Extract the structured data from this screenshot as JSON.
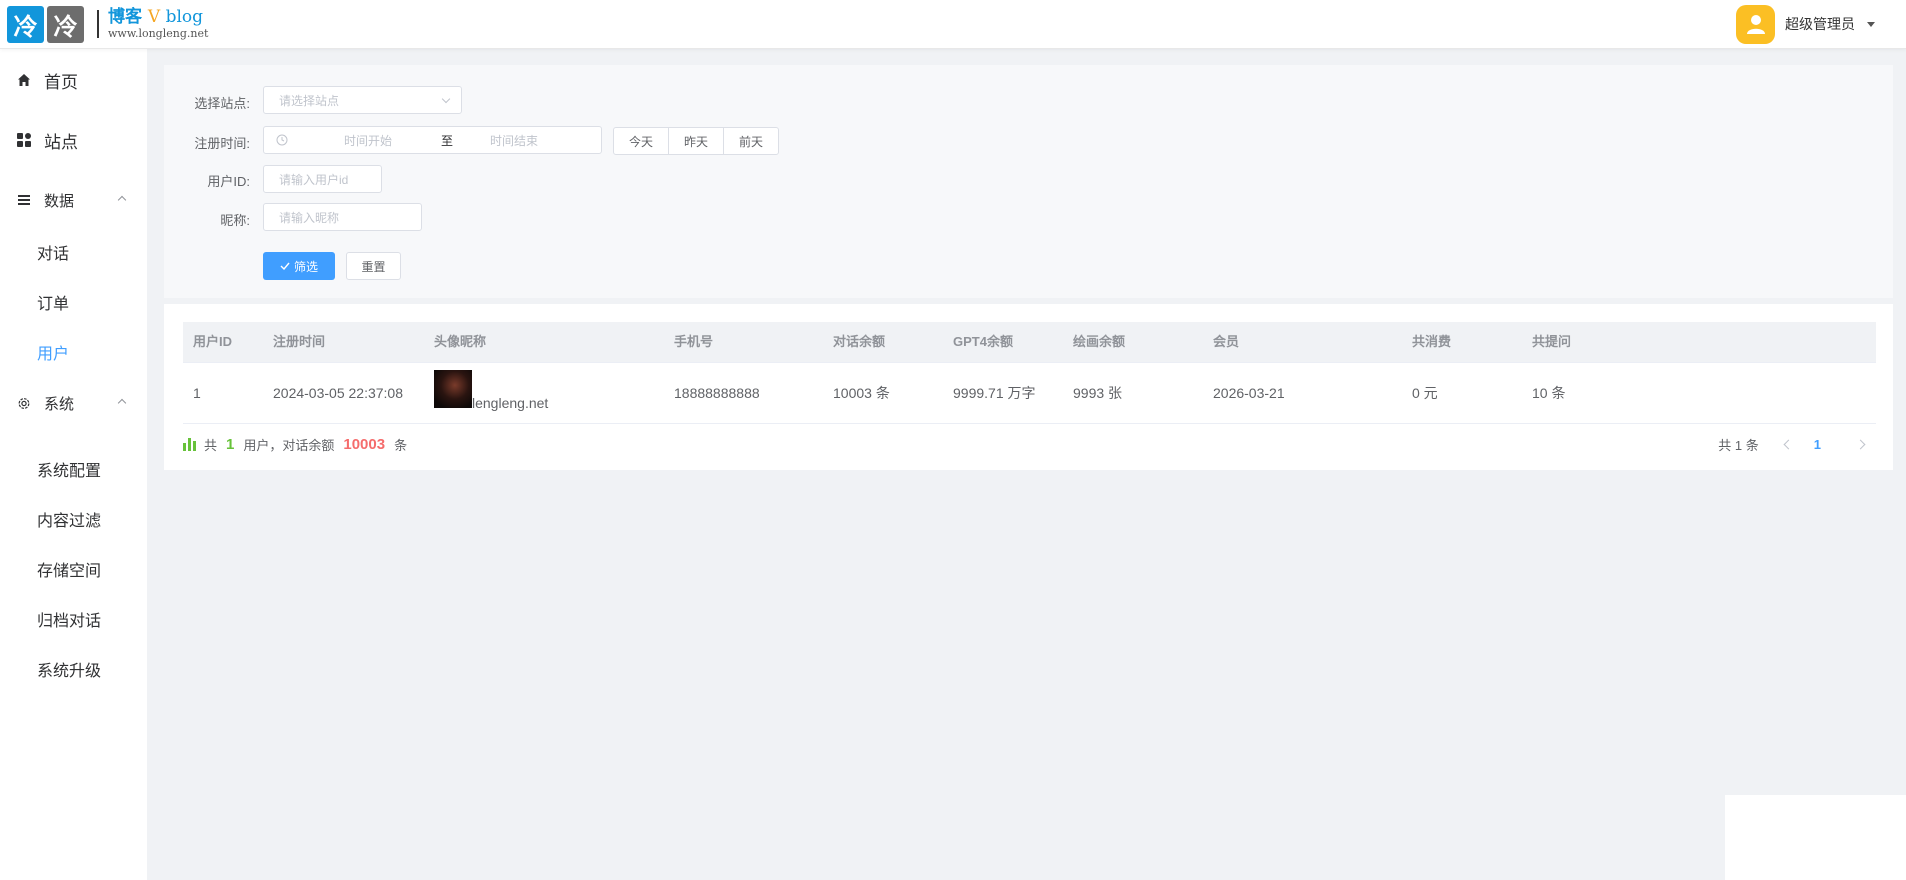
{
  "header": {
    "logo_char_1": "冷",
    "logo_char_2": "冷",
    "logo_title_a": "博客 ",
    "logo_title_v": "V",
    "logo_title_b": " blog",
    "logo_url": "www.longleng.net",
    "user_name": "超级管理员"
  },
  "sidebar": {
    "home": "首页",
    "sites": "站点",
    "data_group": "数据",
    "data_items": [
      "对话",
      "订单",
      "用户"
    ],
    "system_group": "系统",
    "system_items": [
      "系统配置",
      "内容过滤",
      "存储空间",
      "归档对话",
      "系统升级"
    ],
    "active_item": "用户"
  },
  "filters": {
    "site_label": "选择站点:",
    "site_placeholder": "请选择站点",
    "reg_time_label": "注册时间:",
    "time_start_placeholder": "时间开始",
    "time_sep": "至",
    "time_end_placeholder": "时间结束",
    "quick_ranges": [
      "今天",
      "昨天",
      "前天"
    ],
    "user_id_label": "用户ID:",
    "user_id_placeholder": "请输入用户id",
    "nickname_label": "昵称:",
    "nickname_placeholder": "请输入昵称",
    "filter_button": "筛选",
    "reset_button": "重置"
  },
  "table": {
    "columns": [
      "用户ID",
      "注册时间",
      "头像昵称",
      "手机号",
      "对话余额",
      "GPT4余额",
      "绘画余额",
      "会员",
      "共消费",
      "共提问"
    ],
    "rows": [
      {
        "user_id": "1",
        "reg_time": "2024-03-05 22:37:08",
        "nickname": "lengleng.net",
        "phone": "18888888888",
        "chat_balance": "10003 条",
        "gpt4_balance": "9999.71 万字",
        "draw_balance": "9993 张",
        "member": "2026-03-21",
        "total_spent": "0 元",
        "total_questions": "10 条"
      }
    ]
  },
  "summary": {
    "prefix": "共",
    "user_count": "1",
    "mid": "用户，对话余额",
    "balance_total": "10003",
    "suffix": "条"
  },
  "pagination": {
    "total_text": "共 1 条",
    "current_page": "1"
  },
  "colors": {
    "primary": "#409eff",
    "logo_blue": "#1296db",
    "avatar_yellow": "#fbbf24",
    "green": "#67c23a",
    "red": "#f56c6c"
  }
}
